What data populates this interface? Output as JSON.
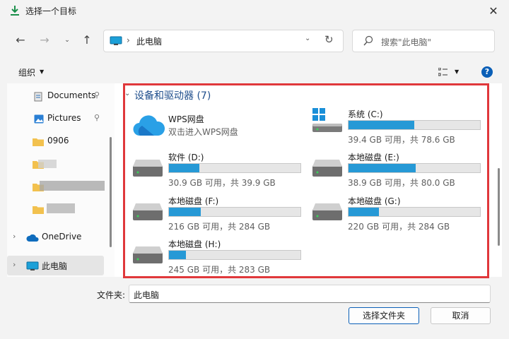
{
  "window": {
    "title": "选择一个目标"
  },
  "nav": {
    "address_text": "此电脑",
    "search_placeholder": "搜索\"此电脑\""
  },
  "commandbar": {
    "organize_label": "组织"
  },
  "sidebar": {
    "items": [
      {
        "label": "Documents",
        "icon": "documents-icon",
        "pinned": true
      },
      {
        "label": "Pictures",
        "icon": "pictures-icon",
        "pinned": true
      },
      {
        "label": "0906",
        "icon": "folder-icon"
      },
      {
        "label": "",
        "icon": "folder-icon"
      },
      {
        "label": "",
        "icon": "folder-icon"
      },
      {
        "label": "",
        "icon": "folder-icon"
      },
      {
        "label": "OneDrive",
        "icon": "onedrive-icon"
      },
      {
        "label": "此电脑",
        "icon": "pc-icon",
        "selected": true
      }
    ]
  },
  "content": {
    "group_header": "设备和驱动器 (7)",
    "drives": [
      {
        "name": "WPS网盘",
        "info": "双击进入WPS网盘",
        "icon": "wps-cloud-icon"
      },
      {
        "name": "系统 (C:)",
        "info": "39.4 GB 可用，共 78.6 GB",
        "used_fraction": 0.5,
        "icon": "windows-drive-icon"
      },
      {
        "name": "软件 (D:)",
        "info": "30.9 GB 可用，共 39.9 GB",
        "used_fraction": 0.23,
        "icon": "drive-icon"
      },
      {
        "name": "本地磁盘 (E:)",
        "info": "38.9 GB 可用，共 80.0 GB",
        "used_fraction": 0.51,
        "icon": "drive-icon"
      },
      {
        "name": "本地磁盘 (F:)",
        "info": "216 GB 可用，共 284 GB",
        "used_fraction": 0.24,
        "icon": "drive-icon"
      },
      {
        "name": "本地磁盘 (G:)",
        "info": "220 GB 可用，共 284 GB",
        "used_fraction": 0.23,
        "icon": "drive-icon"
      },
      {
        "name": "本地磁盘 (H:)",
        "info": "245 GB 可用，共 283 GB",
        "used_fraction": 0.13,
        "icon": "drive-icon"
      }
    ]
  },
  "footer": {
    "folder_label": "文件夹:",
    "folder_value": "此电脑",
    "select_label": "选择文件夹",
    "cancel_label": "取消"
  },
  "colors": {
    "accent": "#0a5fb7",
    "bar_fill": "#2699d6",
    "highlight": "#e0383b"
  }
}
